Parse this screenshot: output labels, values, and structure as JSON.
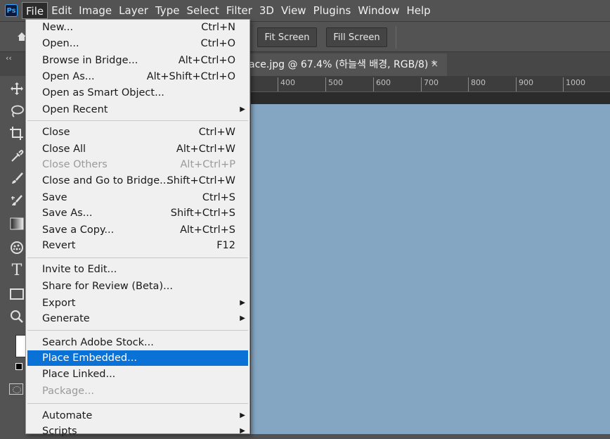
{
  "app": {
    "logo": "Ps"
  },
  "menubar": [
    "File",
    "Edit",
    "Image",
    "Layer",
    "Type",
    "Select",
    "Filter",
    "3D",
    "View",
    "Plugins",
    "Window",
    "Help"
  ],
  "options": {
    "fit_screen": "Fit Screen",
    "fill_screen": "Fill Screen"
  },
  "document_tab": {
    "title": "ace.jpg @ 67.4% (하늘색 배경, RGB/8) *",
    "close": "×"
  },
  "ruler": [
    "400",
    "500",
    "600",
    "700",
    "800",
    "900",
    "1000"
  ],
  "toolbar": {
    "collapse": "‹‹",
    "type_tool": "T"
  },
  "colors": {
    "highlight": "#0a72d6",
    "canvas": "#84a6c3"
  },
  "file_menu": {
    "items": [
      {
        "label": "New...",
        "shortcut": "Ctrl+N"
      },
      {
        "label": "Open...",
        "shortcut": "Ctrl+O"
      },
      {
        "label": "Browse in Bridge...",
        "shortcut": "Alt+Ctrl+O"
      },
      {
        "label": "Open As...",
        "shortcut": "Alt+Shift+Ctrl+O"
      },
      {
        "label": "Open as Smart Object...",
        "shortcut": ""
      },
      {
        "label": "Open Recent",
        "shortcut": "",
        "submenu": true
      },
      {
        "label": "Close",
        "shortcut": "Ctrl+W"
      },
      {
        "label": "Close All",
        "shortcut": "Alt+Ctrl+W"
      },
      {
        "label": "Close Others",
        "shortcut": "Alt+Ctrl+P",
        "disabled": true
      },
      {
        "label": "Close and Go to Bridge...",
        "shortcut": "Shift+Ctrl+W"
      },
      {
        "label": "Save",
        "shortcut": "Ctrl+S"
      },
      {
        "label": "Save As...",
        "shortcut": "Shift+Ctrl+S"
      },
      {
        "label": "Save a Copy...",
        "shortcut": "Alt+Ctrl+S"
      },
      {
        "label": "Revert",
        "shortcut": "F12"
      },
      {
        "label": "Invite to Edit...",
        "shortcut": ""
      },
      {
        "label": "Share for Review (Beta)...",
        "shortcut": ""
      },
      {
        "label": "Export",
        "shortcut": "",
        "submenu": true
      },
      {
        "label": "Generate",
        "shortcut": "",
        "submenu": true
      },
      {
        "label": "Search Adobe Stock...",
        "shortcut": ""
      },
      {
        "label": "Place Embedded...",
        "shortcut": "",
        "highlighted": true
      },
      {
        "label": "Place Linked...",
        "shortcut": ""
      },
      {
        "label": "Package...",
        "shortcut": "",
        "disabled": true
      },
      {
        "label": "Automate",
        "shortcut": "",
        "submenu": true
      },
      {
        "label": "Scripts",
        "shortcut": "",
        "submenu": true
      }
    ]
  }
}
